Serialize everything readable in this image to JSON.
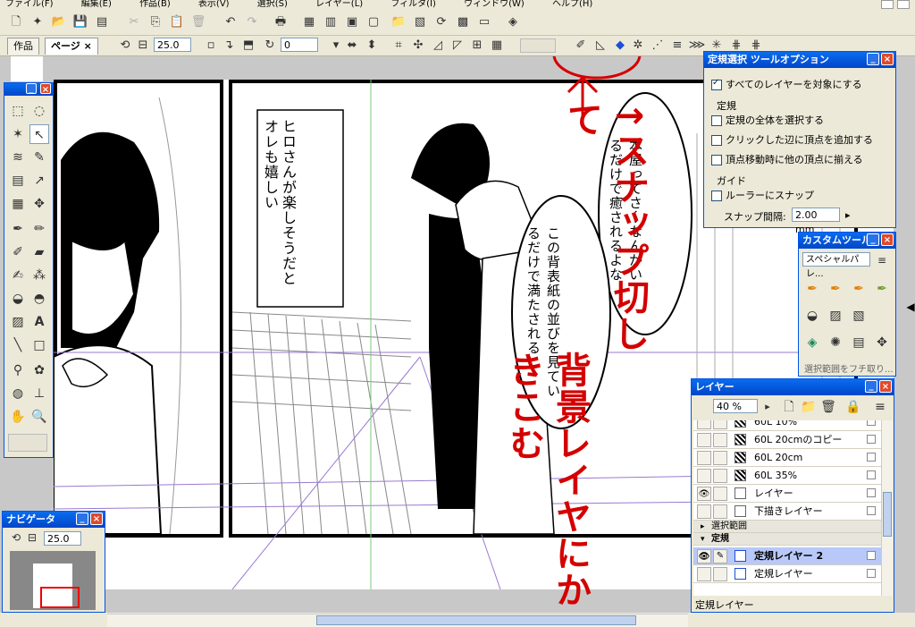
{
  "menubar": {
    "items": [
      "ファイル(F)",
      "編集(E)",
      "作品(B)",
      "表示(V)",
      "選択(S)",
      "レイヤー(L)",
      "フィルタ(I)",
      "ウィンドウ(W)",
      "ヘルプ(H)"
    ]
  },
  "tabs": {
    "work": "作品",
    "page": "ページ ×"
  },
  "toolbar2": {
    "zoom_value": "25.0",
    "angle_value": "0"
  },
  "tool_options": {
    "title": "定規選択 ツールオプション",
    "select_all_layers": "すべてのレイヤーを対象にする",
    "section_ruler": "定規",
    "opt_select_whole": "定規の全体を選択する",
    "opt_add_vertex": "クリックした辺に頂点を追加する",
    "opt_align_vertex": "頂点移動時に他の頂点に揃える",
    "section_guide": "ガイド",
    "opt_snap_ruler": "ルーラーにスナップ",
    "snap_interval_label": "スナップ間隔:",
    "snap_interval_value": "2.00 mm"
  },
  "custom_tools": {
    "title": "カスタムツール",
    "dropdown_value": "スペシャルパレ...",
    "bottom_label": "選択範囲をフチ取り..."
  },
  "layers": {
    "title": "レイヤー",
    "opacity": "40 %",
    "rows": [
      {
        "name": "60L 10%",
        "eye": false,
        "thumb": "tone"
      },
      {
        "name": "60L 20cmのコピー",
        "eye": false,
        "thumb": "tone"
      },
      {
        "name": "60L 20cm",
        "eye": false,
        "thumb": "tone"
      },
      {
        "name": "60L 35%",
        "eye": false,
        "thumb": "tone"
      },
      {
        "name": "レイヤー",
        "eye": true,
        "thumb": "blank"
      },
      {
        "name": "下描きレイヤー",
        "eye": false,
        "thumb": "blank"
      }
    ],
    "folder_selection": "選択範囲",
    "folder_ruler": "定規",
    "ruler_rows": [
      {
        "name": "定規レイヤー 2",
        "selected": true
      },
      {
        "name": "定規レイヤー",
        "selected": false
      }
    ],
    "status": "定規レイヤー"
  },
  "navigator": {
    "title": "ナビゲータ",
    "zoom_value": "25.0"
  },
  "manga": {
    "bubble_left": "ヒロさんが楽しそうだとオレも嬉しい",
    "bubble_right_1": "本屋ってさ～なんかいるだけで癒されるよな",
    "bubble_right_2": "この背表紙の並びを見ているだけで満たされる…"
  },
  "annotations": {
    "snap_off": "↑スナップ切して",
    "draw_on": "背景レイヤにかきこむ",
    "accent_color": "#d40000"
  }
}
